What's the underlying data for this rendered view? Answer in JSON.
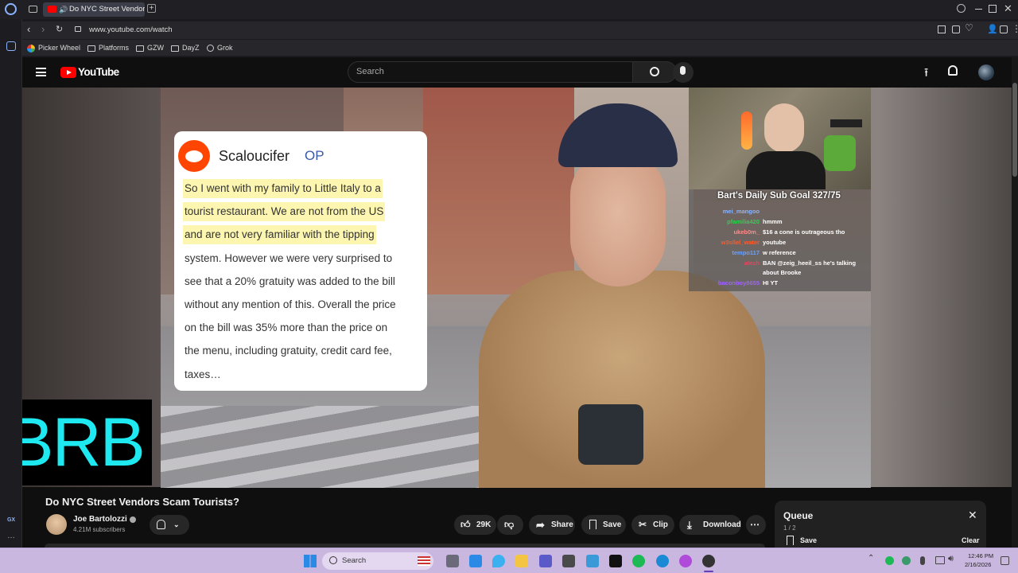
{
  "browser": {
    "tab_title": "Do NYC Street Vendors",
    "url": "www.youtube.com/watch",
    "bookmarks": [
      "Picker Wheel",
      "Platforms",
      "GZW",
      "DayZ",
      "Grok"
    ],
    "sidebar_badge": "GX"
  },
  "youtube": {
    "logo_text": "YouTube",
    "search_placeholder": "Search"
  },
  "video": {
    "reddit_user": "Scaloucifer",
    "reddit_tag": "OP",
    "reddit_lines": [
      "So I went with my family to Little Italy to a",
      "tourist restaurant. We are not from the US",
      "and are not very familiar with the tipping",
      "system. However we were very surprised to",
      "see that a 20% gratuity was added to the bill",
      "without any mention of this. Overall the price",
      "on the bill was 35% more than the price on",
      "the menu, including gratuity, credit card fee,",
      "taxes…"
    ],
    "highlighted_lines": 3,
    "stream_goal": "Bart's Daily Sub Goal 327/75",
    "chat": [
      {
        "user": "mei_mangoo",
        "msg": "",
        "color": "#8ab4ff"
      },
      {
        "user": "pfamilia420",
        "msg": "hmmm",
        "color": "#2ad24b"
      },
      {
        "user": "ukeb0m_",
        "msg": "$16 a cone is outrageous tho",
        "color": "#ff8a8a"
      },
      {
        "user": "w3sllel_water",
        "msg": "youtube",
        "color": "#ff5a2a"
      },
      {
        "user": "tempo117",
        "msg": "w reference",
        "color": "#6aa0ff"
      },
      {
        "user": "alesh",
        "msg": "BAN @zeig_heeil_ss he's talking",
        "color": "#ff3a5a"
      },
      {
        "user": "",
        "msg": "about Brooke",
        "color": "#ffffff"
      },
      {
        "user": "baconboy8655",
        "msg": "HI YT",
        "color": "#a060ff"
      }
    ],
    "brb_text": "BRB"
  },
  "watch": {
    "title": "Do NYC Street Vendors Scam Tourists?",
    "channel": "Joe Bartolozzi",
    "subscribers": "4.21M subscribers",
    "likes": "29K",
    "share": "Share",
    "save": "Save",
    "clip": "Clip",
    "download": "Download"
  },
  "queue": {
    "title": "Queue",
    "position": "1 / 2",
    "save": "Save",
    "clear": "Clear"
  },
  "taskbar": {
    "search": "Search",
    "time": "12:46 PM",
    "date": "2/16/2026"
  },
  "colors": {
    "cyan": "#1ee8f0",
    "youtube_red": "#ff0000",
    "highlight": "#fdf6b0",
    "reddit_orange": "#ff4500",
    "op_blue": "#3a5aa8"
  }
}
